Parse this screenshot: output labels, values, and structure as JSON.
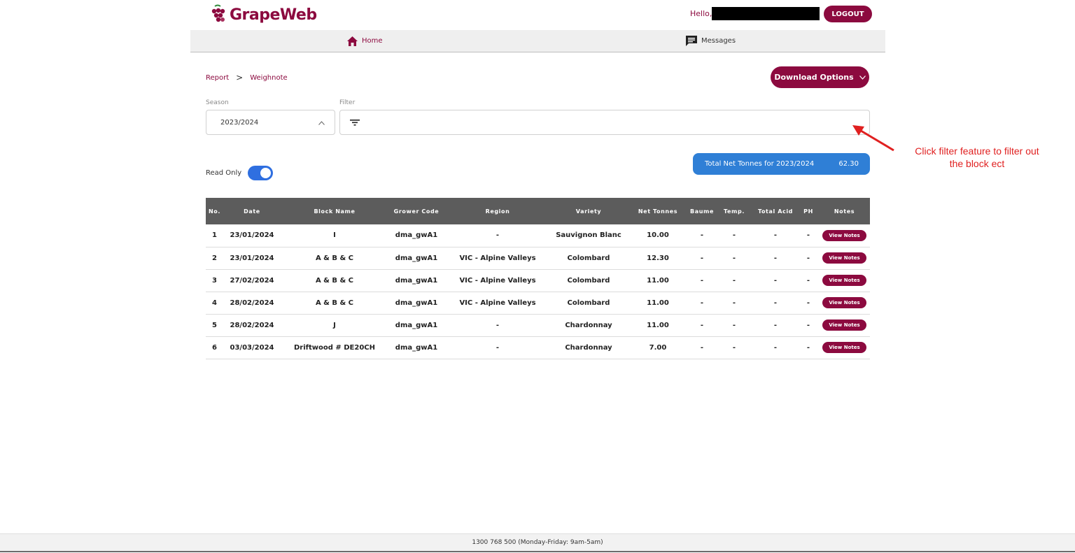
{
  "brand": {
    "name_part1": "Grape",
    "name_part2": "Web",
    "mark": "GW"
  },
  "header": {
    "greeting": "Hello,",
    "logout_label": "LOGOUT"
  },
  "nav": {
    "home_label": "Home",
    "messages_label": "Messages"
  },
  "breadcrumb": {
    "root": "Report",
    "separator": ">",
    "current": "Weighnote"
  },
  "download_label": "Download Options",
  "season": {
    "label": "Season",
    "value": "2023/2024"
  },
  "filter": {
    "label": "Filter",
    "value": ""
  },
  "total": {
    "label": "Total Net Tonnes for 2023/2024",
    "value": "62.30"
  },
  "read_only": {
    "label": "Read Only",
    "on": true
  },
  "table": {
    "headers": [
      "No.",
      "Date",
      "Block Name",
      "Grower Code",
      "Region",
      "Variety",
      "Net Tonnes",
      "Baume",
      "Temp.",
      "Total Acid",
      "PH",
      "Notes"
    ],
    "rows": [
      {
        "no": "1",
        "date": "23/01/2024",
        "block": "I",
        "grower": "dma_gwA1",
        "region": "-",
        "variety": "Sauvignon Blanc",
        "net": "10.00",
        "baume": "-",
        "temp": "-",
        "acid": "-",
        "ph": "-",
        "notes": "View Notes"
      },
      {
        "no": "2",
        "date": "23/01/2024",
        "block": "A & B & C",
        "grower": "dma_gwA1",
        "region": "VIC - Alpine Valleys",
        "variety": "Colombard",
        "net": "12.30",
        "baume": "-",
        "temp": "-",
        "acid": "-",
        "ph": "-",
        "notes": "View Notes"
      },
      {
        "no": "3",
        "date": "27/02/2024",
        "block": "A & B & C",
        "grower": "dma_gwA1",
        "region": "VIC - Alpine Valleys",
        "variety": "Colombard",
        "net": "11.00",
        "baume": "-",
        "temp": "-",
        "acid": "-",
        "ph": "-",
        "notes": "View Notes"
      },
      {
        "no": "4",
        "date": "28/02/2024",
        "block": "A & B & C",
        "grower": "dma_gwA1",
        "region": "VIC - Alpine Valleys",
        "variety": "Colombard",
        "net": "11.00",
        "baume": "-",
        "temp": "-",
        "acid": "-",
        "ph": "-",
        "notes": "View Notes"
      },
      {
        "no": "5",
        "date": "28/02/2024",
        "block": "J",
        "grower": "dma_gwA1",
        "region": "-",
        "variety": "Chardonnay",
        "net": "11.00",
        "baume": "-",
        "temp": "-",
        "acid": "-",
        "ph": "-",
        "notes": "View Notes"
      },
      {
        "no": "6",
        "date": "03/03/2024",
        "block": "Driftwood # DE20CH",
        "grower": "dma_gwA1",
        "region": "-",
        "variety": "Chardonnay",
        "net": "7.00",
        "baume": "-",
        "temp": "-",
        "acid": "-",
        "ph": "-",
        "notes": "View Notes"
      }
    ]
  },
  "annotation": {
    "line1": "Click filter feature to filter out",
    "line2": "the block ect"
  },
  "footer": {
    "text": "1300 768 500 (Monday-Friday: 9am-5am)"
  },
  "colors": {
    "brand": "#8c0a3f",
    "brand_green": "#2f8a3a",
    "total_bg": "#2f7fd6",
    "toggle": "#2f6fe0",
    "table_header": "#5c5c5c",
    "annotation": "#e02020"
  },
  "icons": [
    "grapeweb-logo-icon",
    "home-icon",
    "message-icon",
    "chevron-right-icon",
    "chevron-down-icon",
    "chevron-up-icon",
    "filter-icon",
    "arrow-annotation-icon"
  ]
}
